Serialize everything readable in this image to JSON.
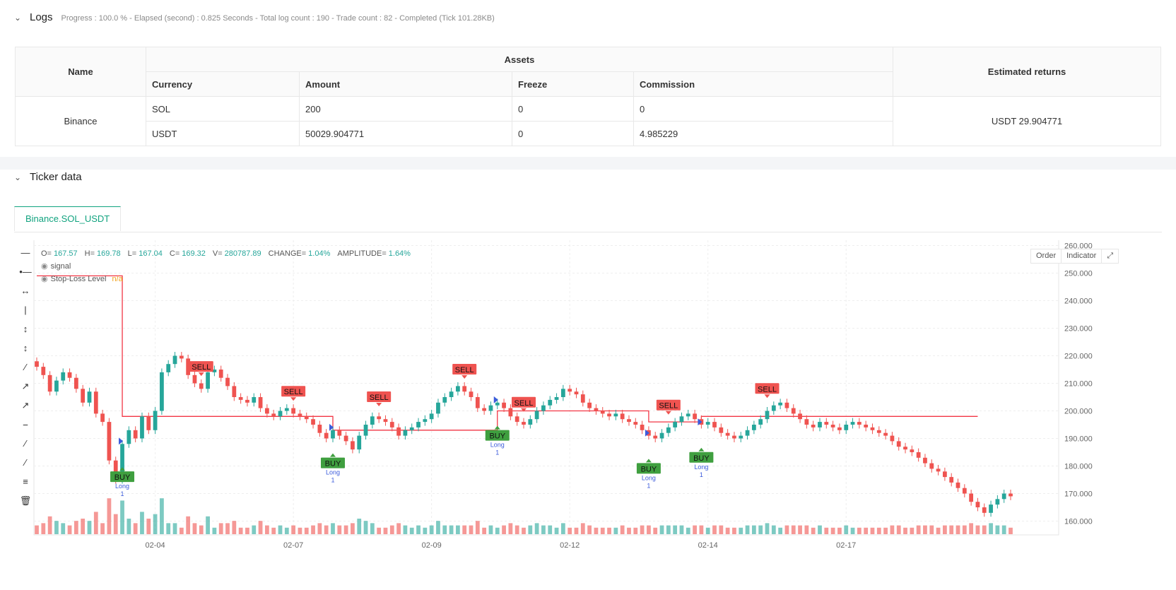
{
  "logs": {
    "title": "Logs",
    "summary": "Progress : 100.0 % - Elapsed (second) : 0.825  Seconds - Total log count : 190 - Trade count : 82 - Completed (Tick 101.28KB)"
  },
  "assets_table": {
    "headers": {
      "name": "Name",
      "assets": "Assets",
      "estimated": "Estimated returns",
      "currency": "Currency",
      "amount": "Amount",
      "freeze": "Freeze",
      "commission": "Commission"
    },
    "exchange": "Binance",
    "rows": [
      {
        "currency": "SOL",
        "amount": "200",
        "freeze": "0",
        "commission": "0"
      },
      {
        "currency": "USDT",
        "amount": "50029.904771",
        "freeze": "0",
        "commission": "4.985229"
      }
    ],
    "estimated_returns": "USDT 29.904771"
  },
  "ticker": {
    "title": "Ticker data",
    "tab": "Binance.SOL_USDT"
  },
  "legend": {
    "ohlc": [
      {
        "k": "O=",
        "v": "167.57"
      },
      {
        "k": "H=",
        "v": "169.78"
      },
      {
        "k": "L=",
        "v": "167.04"
      },
      {
        "k": "C=",
        "v": "169.32"
      },
      {
        "k": "V=",
        "v": "280787.89"
      },
      {
        "k": "CHANGE=",
        "v": "1.04%"
      },
      {
        "k": "AMPLITUDE=",
        "v": "1.64%"
      }
    ],
    "signal": "signal",
    "stop_loss": "Stop-Loss Level",
    "stop_loss_value": "n/a"
  },
  "chart_buttons": {
    "order": "Order",
    "indicator": "Indicator"
  },
  "colors": {
    "up": "#26a69a",
    "down": "#ef5350",
    "stop": "#f23645",
    "buy": "#3f9f3f",
    "sell": "#ef5350",
    "accent": "#11a37f",
    "long": "#3b5bdb"
  },
  "chart_data": {
    "type": "candlestick",
    "ylim": [
      155,
      265
    ],
    "y_ticks": [
      "160.000",
      "170.000",
      "180.000",
      "190.000",
      "200.000",
      "210.000",
      "220.000",
      "230.000",
      "240.000",
      "250.000",
      "260.000"
    ],
    "x_ticks": [
      {
        "label": "02-04",
        "index": 18
      },
      {
        "label": "02-07",
        "index": 39
      },
      {
        "label": "02-09",
        "index": 60
      },
      {
        "label": "02-12",
        "index": 81
      },
      {
        "label": "02-14",
        "index": 102
      },
      {
        "label": "02-17",
        "index": 123
      }
    ],
    "closes": [
      216,
      213,
      207,
      211,
      214,
      212,
      208,
      203,
      207,
      199,
      196,
      182,
      175,
      188,
      193,
      190,
      198,
      193,
      200,
      214,
      217,
      220,
      219,
      213,
      210,
      208,
      214,
      215,
      212,
      209,
      205,
      204,
      203,
      205,
      201,
      199,
      198,
      200,
      201,
      199,
      198,
      197,
      195,
      192,
      190,
      193,
      191,
      189,
      186,
      191,
      195,
      198,
      197,
      196,
      194,
      191,
      193,
      194,
      196,
      197,
      199,
      203,
      205,
      207,
      209,
      207,
      205,
      201,
      200,
      202,
      203,
      201,
      198,
      196,
      195,
      197,
      200,
      202,
      204,
      205,
      208,
      207,
      206,
      203,
      201,
      200,
      199,
      198,
      199,
      197,
      196,
      195,
      193,
      191,
      190,
      192,
      194,
      196,
      198,
      199,
      197,
      195,
      196,
      194,
      192,
      191,
      190,
      191,
      193,
      195,
      197,
      200,
      202,
      203,
      201,
      199,
      197,
      195,
      194,
      196,
      195,
      194,
      193,
      195,
      196,
      195,
      194,
      193,
      192,
      191,
      189,
      187,
      186,
      185,
      183,
      181,
      179,
      178,
      176,
      174,
      172,
      170,
      167,
      165,
      163,
      166,
      168,
      170,
      169
    ]
  },
  "annotations": {
    "buy_label": "BUY",
    "sell_label": "SELL",
    "long_label": "Long",
    "qty_label": "1",
    "buys": [
      13,
      45,
      70,
      93,
      101
    ],
    "sells": [
      25,
      39,
      52,
      65,
      74,
      96,
      111
    ]
  },
  "stop_loss_line": [
    {
      "from": 0,
      "to": 13,
      "y": 249
    },
    {
      "from": 13,
      "to": 45,
      "y": 198
    },
    {
      "from": 45,
      "to": 70,
      "y": 193
    },
    {
      "from": 70,
      "to": 93,
      "y": 200
    },
    {
      "from": 93,
      "to": 101,
      "y": 196
    },
    {
      "from": 101,
      "to": 143,
      "y": 198
    }
  ]
}
